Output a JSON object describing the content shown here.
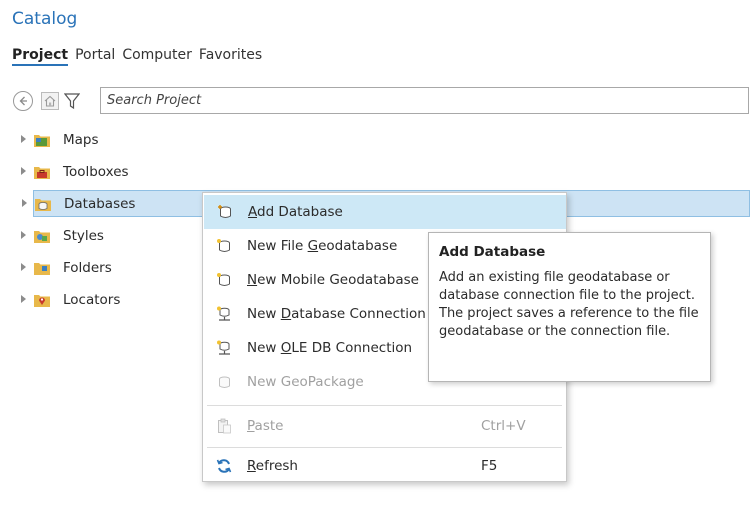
{
  "pane": {
    "title": "Catalog"
  },
  "tabs": [
    {
      "label": "Project",
      "active": true
    },
    {
      "label": "Portal",
      "active": false
    },
    {
      "label": "Computer",
      "active": false
    },
    {
      "label": "Favorites",
      "active": false
    }
  ],
  "search": {
    "placeholder": "Search Project",
    "value": ""
  },
  "tree": {
    "items": [
      {
        "label": "Maps",
        "icon": "map-folder-icon",
        "selected": false
      },
      {
        "label": "Toolboxes",
        "icon": "toolbox-folder-icon",
        "selected": false
      },
      {
        "label": "Databases",
        "icon": "database-folder-icon",
        "selected": true
      },
      {
        "label": "Styles",
        "icon": "styles-folder-icon",
        "selected": false
      },
      {
        "label": "Folders",
        "icon": "folder-icon",
        "selected": false
      },
      {
        "label": "Locators",
        "icon": "locator-folder-icon",
        "selected": false
      }
    ]
  },
  "context_menu": {
    "items": [
      {
        "label": "Add Database",
        "underline": "A",
        "icon": "add-database-icon",
        "shortcut": "",
        "enabled": true,
        "hover": true
      },
      {
        "label": "New File Geodatabase",
        "underline": "G",
        "icon": "new-file-geodatabase-icon",
        "shortcut": "",
        "enabled": true,
        "hover": false
      },
      {
        "label": "New Mobile Geodatabase",
        "underline": "N",
        "icon": "new-mobile-geodatabase-icon",
        "shortcut": "",
        "enabled": true,
        "hover": false
      },
      {
        "label": "New Database Connection",
        "underline": "D",
        "icon": "new-database-connection-icon",
        "shortcut": "",
        "enabled": true,
        "hover": false
      },
      {
        "label": "New OLE DB Connection",
        "underline": "O",
        "icon": "new-ole-db-connection-icon",
        "shortcut": "",
        "enabled": true,
        "hover": false
      },
      {
        "label": "New GeoPackage",
        "underline": "",
        "icon": "new-geopackage-icon",
        "shortcut": "",
        "enabled": false,
        "hover": false
      },
      {
        "label": "Paste",
        "underline": "P",
        "icon": "paste-icon",
        "shortcut": "Ctrl+V",
        "enabled": false,
        "hover": false
      },
      {
        "label": "Refresh",
        "underline": "R",
        "icon": "refresh-icon",
        "shortcut": "F5",
        "enabled": true,
        "hover": false
      }
    ]
  },
  "tooltip": {
    "title": "Add Database",
    "body": "Add an existing file geodatabase or database connection file to the project. The project saves a reference to the file geodatabase or the connection file."
  },
  "colors": {
    "accent": "#2a73b8",
    "selection": "#cde3f4",
    "hover": "#cde8f6",
    "disabled": "#a0a0a0"
  }
}
